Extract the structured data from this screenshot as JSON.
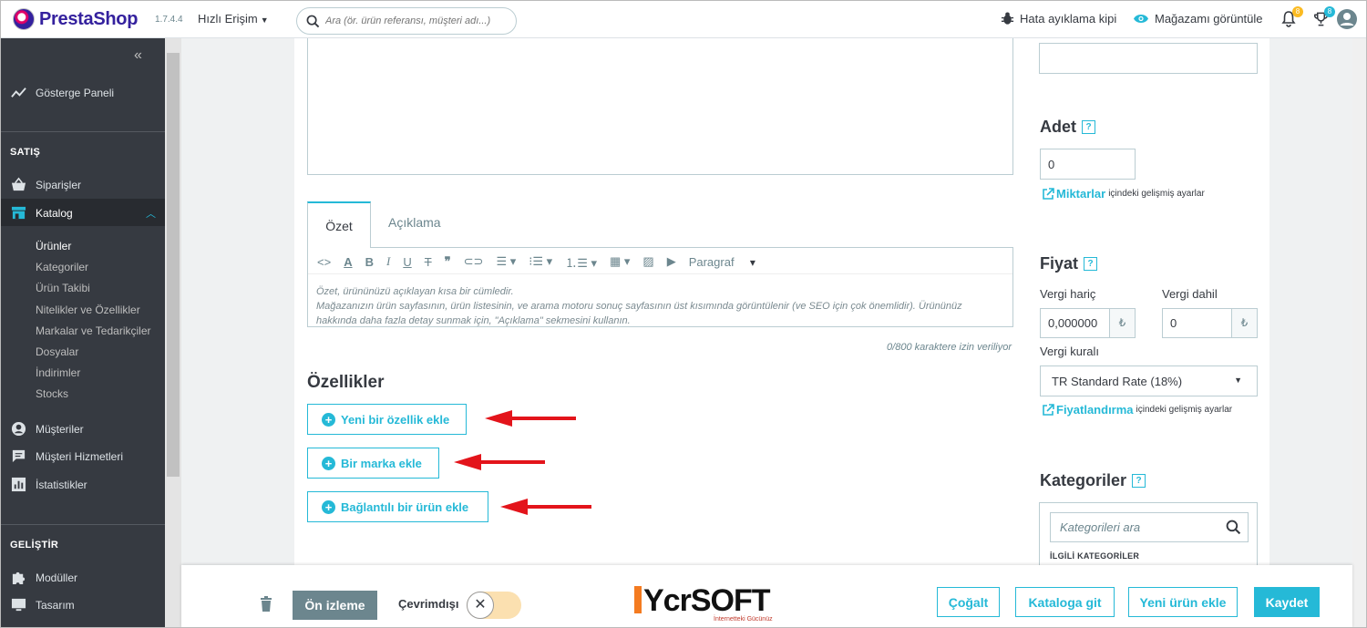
{
  "topbar": {
    "brand": "PrestaShop",
    "version": "1.7.4.4",
    "quick_access": "Hızlı Erişim",
    "search_placeholder": "Ara (ör. ürün referansı, müşteri adı...)",
    "debug_mode": "Hata ayıklama kipi",
    "view_store": "Mağazamı görüntüle",
    "notif_badge_1": "8",
    "notif_badge_2": "8"
  },
  "sidebar": {
    "dashboard": "Gösterge Paneli",
    "section_sell": "SATIŞ",
    "orders": "Siparişler",
    "catalog": "Katalog",
    "catalog_sub": [
      "Ürünler",
      "Kategoriler",
      "Ürün Takibi",
      "Nitelikler ve Özellikler",
      "Markalar ve Tedarikçiler",
      "Dosyalar",
      "İndirimler",
      "Stocks"
    ],
    "customers": "Müşteriler",
    "customer_service": "Müşteri Hizmetleri",
    "stats": "İstatistikler",
    "section_improve": "GELİŞTİR",
    "modules": "Modüller",
    "design": "Tasarım"
  },
  "editor": {
    "tab_summary": "Özet",
    "tab_description": "Açıklama",
    "paragraph_label": "Paragraf",
    "summary_placeholder_1": "Özet, ürününüzü açıklayan kısa bir cümledir.",
    "summary_placeholder_2": "Mağazanızın ürün sayfasının, ürün listesinin, ve arama motoru sonuç sayfasının üst kısımında görüntülenir (ve SEO için çok önemlidir). Ürününüz hakkında daha fazla detay sunmak için, \"Açıklama\" sekmesini kullanın.",
    "char_counter": "0/800 karaktere izin veriliyor"
  },
  "features": {
    "title": "Özellikler",
    "add_feature": "Yeni bir özellik ekle",
    "add_brand": "Bir marka ekle",
    "add_related": "Bağlantılı bir ürün ekle"
  },
  "right": {
    "quantity_title": "Adet",
    "quantity_value": "0",
    "quantities_link": "Miktarlar",
    "advanced_settings": "içindeki gelişmiş ayarlar",
    "price_title": "Fiyat",
    "tax_excl_label": "Vergi hariç",
    "tax_incl_label": "Vergi dahil",
    "tax_excl_value": "0,000000",
    "tax_incl_value": "0",
    "currency_symbol": "₺",
    "tax_rule_label": "Vergi kuralı",
    "tax_rule_value": "TR Standard Rate (18%)",
    "pricing_link": "Fiyatlandırma",
    "categories_title": "Kategoriler",
    "categories_search_placeholder": "Kategorileri ara",
    "related_categories": "İLGİLİ KATEGORİLER",
    "help_mark": "?"
  },
  "footer": {
    "preview": "Ön izleme",
    "offline": "Çevrimdışı",
    "brand": "YcrSOFT",
    "brand_tagline": "İnternetteki Gücünüz",
    "duplicate": "Çoğalt",
    "goto_catalog": "Kataloga git",
    "add_new_product": "Yeni ürün ekle",
    "save": "Kaydet"
  },
  "colors": {
    "accent": "#25b9d7",
    "sidebar_bg": "#363a41",
    "arrow": "#e3141b"
  }
}
